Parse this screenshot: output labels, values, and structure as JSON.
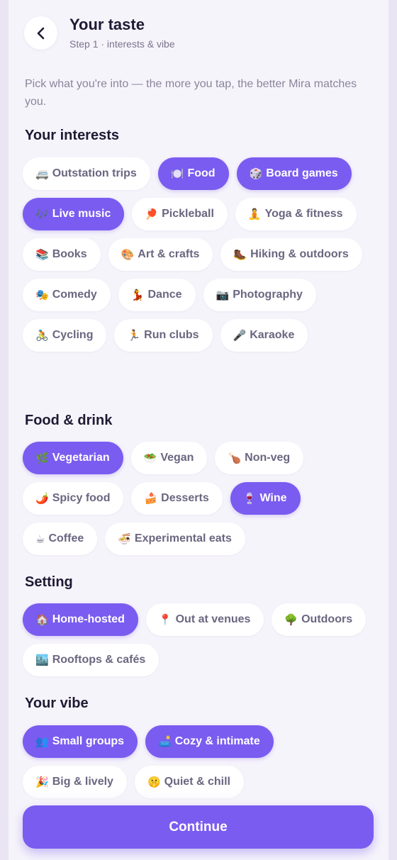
{
  "header": {
    "title": "Your taste",
    "subtitle": "Step 1 · interests & vibe"
  },
  "intro": "Pick what you're into — the more you tap, the better Mira matches you.",
  "accent_color": "#7A5CF0",
  "sections": [
    {
      "title": "Your interests",
      "chips": [
        {
          "emoji": "🚐",
          "label": "Outstation trips",
          "selected": false
        },
        {
          "emoji": "🍽️",
          "label": "Food",
          "selected": true
        },
        {
          "emoji": "🎲",
          "label": "Board games",
          "selected": true
        },
        {
          "emoji": "🎶",
          "label": "Live music",
          "selected": true
        },
        {
          "emoji": "🏓",
          "label": "Pickleball",
          "selected": false
        },
        {
          "emoji": "🧘",
          "label": "Yoga & fitness",
          "selected": false
        },
        {
          "emoji": "📚",
          "label": "Books",
          "selected": false
        },
        {
          "emoji": "🎨",
          "label": "Art & crafts",
          "selected": false
        },
        {
          "emoji": "🥾",
          "label": "Hiking & outdoors",
          "selected": false
        },
        {
          "emoji": "🎭",
          "label": "Comedy",
          "selected": false
        },
        {
          "emoji": "💃",
          "label": "Dance",
          "selected": false
        },
        {
          "emoji": "📷",
          "label": "Photography",
          "selected": false
        },
        {
          "emoji": "🚴",
          "label": "Cycling",
          "selected": false
        },
        {
          "emoji": "🏃",
          "label": "Run clubs",
          "selected": false
        },
        {
          "emoji": "🎤",
          "label": "Karaoke",
          "selected": false
        }
      ]
    },
    {
      "title": "Food & drink",
      "chips": [
        {
          "emoji": "🌿",
          "label": "Vegetarian",
          "selected": true
        },
        {
          "emoji": "🥗",
          "label": "Vegan",
          "selected": false
        },
        {
          "emoji": "🍗",
          "label": "Non-veg",
          "selected": false
        },
        {
          "emoji": "🌶️",
          "label": "Spicy food",
          "selected": false
        },
        {
          "emoji": "🍰",
          "label": "Desserts",
          "selected": false
        },
        {
          "emoji": "🍷",
          "label": "Wine",
          "selected": true
        },
        {
          "emoji": "☕",
          "label": "Coffee",
          "selected": false
        },
        {
          "emoji": "🍜",
          "label": "Experimental eats",
          "selected": false
        }
      ]
    },
    {
      "title": "Setting",
      "chips": [
        {
          "emoji": "🏠",
          "label": "Home-hosted",
          "selected": true
        },
        {
          "emoji": "📍",
          "label": "Out at venues",
          "selected": false
        },
        {
          "emoji": "🌳",
          "label": "Outdoors",
          "selected": false
        },
        {
          "emoji": "🏙️",
          "label": "Rooftops & cafés",
          "selected": false
        }
      ]
    },
    {
      "title": "Your vibe",
      "chips": [
        {
          "emoji": "👥",
          "label": "Small groups",
          "selected": true
        },
        {
          "emoji": "🛋️",
          "label": "Cozy & intimate",
          "selected": true
        },
        {
          "emoji": "🎉",
          "label": "Big & lively",
          "selected": false
        },
        {
          "emoji": "🤫",
          "label": "Quiet & chill",
          "selected": false
        }
      ]
    }
  ],
  "continue_label": "Continue"
}
